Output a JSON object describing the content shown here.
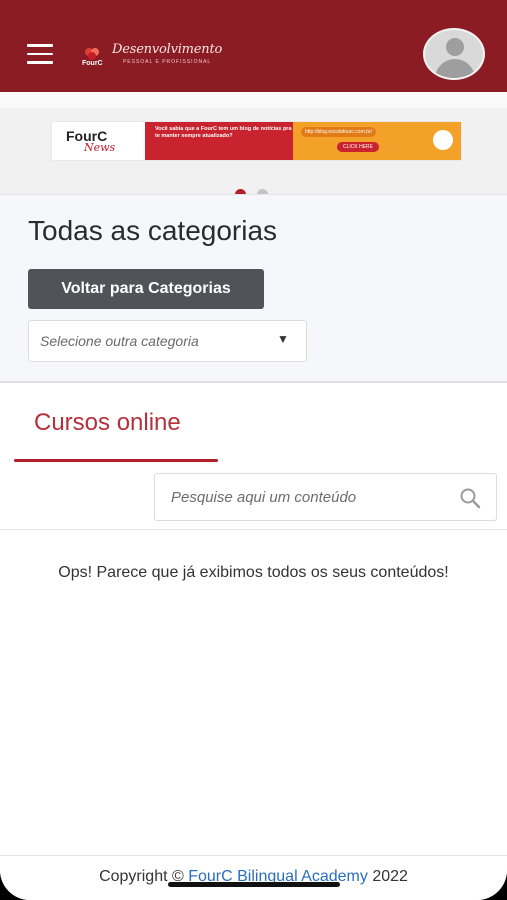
{
  "header": {
    "brand_short": "FourC",
    "brand_script": "Desenvolvimento",
    "brand_sub": "PESSOAL E PROFISSIONAL"
  },
  "banner": {
    "logo_text": "FourC",
    "logo_script": "News",
    "message": "Você sabia que a FourC tem um blog de notícias pra te manter sempre atualizado?",
    "url": "http://blog.escolafourc.com.br/",
    "cta": "CLICK HERE",
    "slides_total": 2,
    "active_slide": 1
  },
  "category": {
    "title": "Todas as categorias",
    "back_button": "Voltar para Categorias",
    "select_placeholder": "Selecione outra categoria",
    "caret": "▼"
  },
  "tabs": {
    "active": "Cursos online"
  },
  "search": {
    "placeholder": "Pesquise aqui um conteúdo"
  },
  "empty_state": "Ops! Parece que já exibimos todos os seus conteúdos!",
  "footer": {
    "prefix": "Copyright ©",
    "link": "FourC Bilingual Academy",
    "year": "2022"
  },
  "colors": {
    "brand": "#8c1c24",
    "accent": "#b0202b",
    "button": "#505459",
    "link": "#2a6fbf"
  }
}
